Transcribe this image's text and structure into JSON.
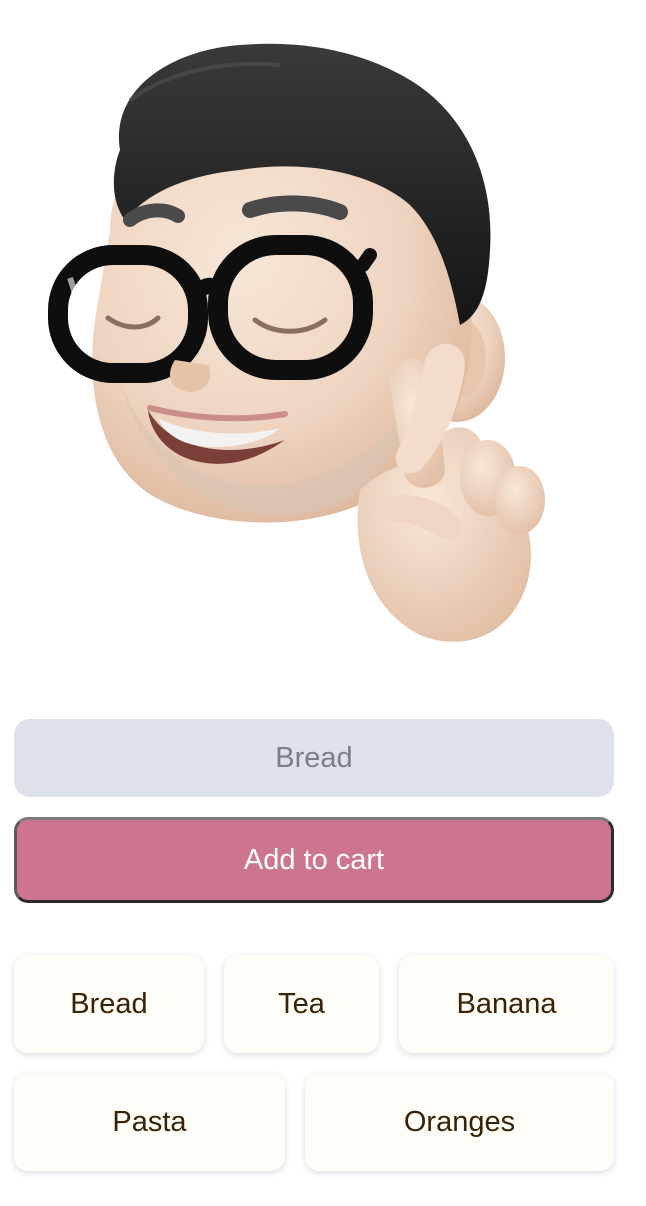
{
  "search": {
    "placeholder": "Bread",
    "value": ""
  },
  "actions": {
    "add_to_cart_label": "Add to cart"
  },
  "suggestions": [
    {
      "label": "Bread"
    },
    {
      "label": "Tea"
    },
    {
      "label": "Banana"
    },
    {
      "label": "Pasta"
    },
    {
      "label": "Oranges"
    }
  ],
  "colors": {
    "input_bg": "#dde1ea",
    "button_bg": "#cd748f",
    "chip_bg": "#fffdf7",
    "chip_text": "#3a2206"
  }
}
